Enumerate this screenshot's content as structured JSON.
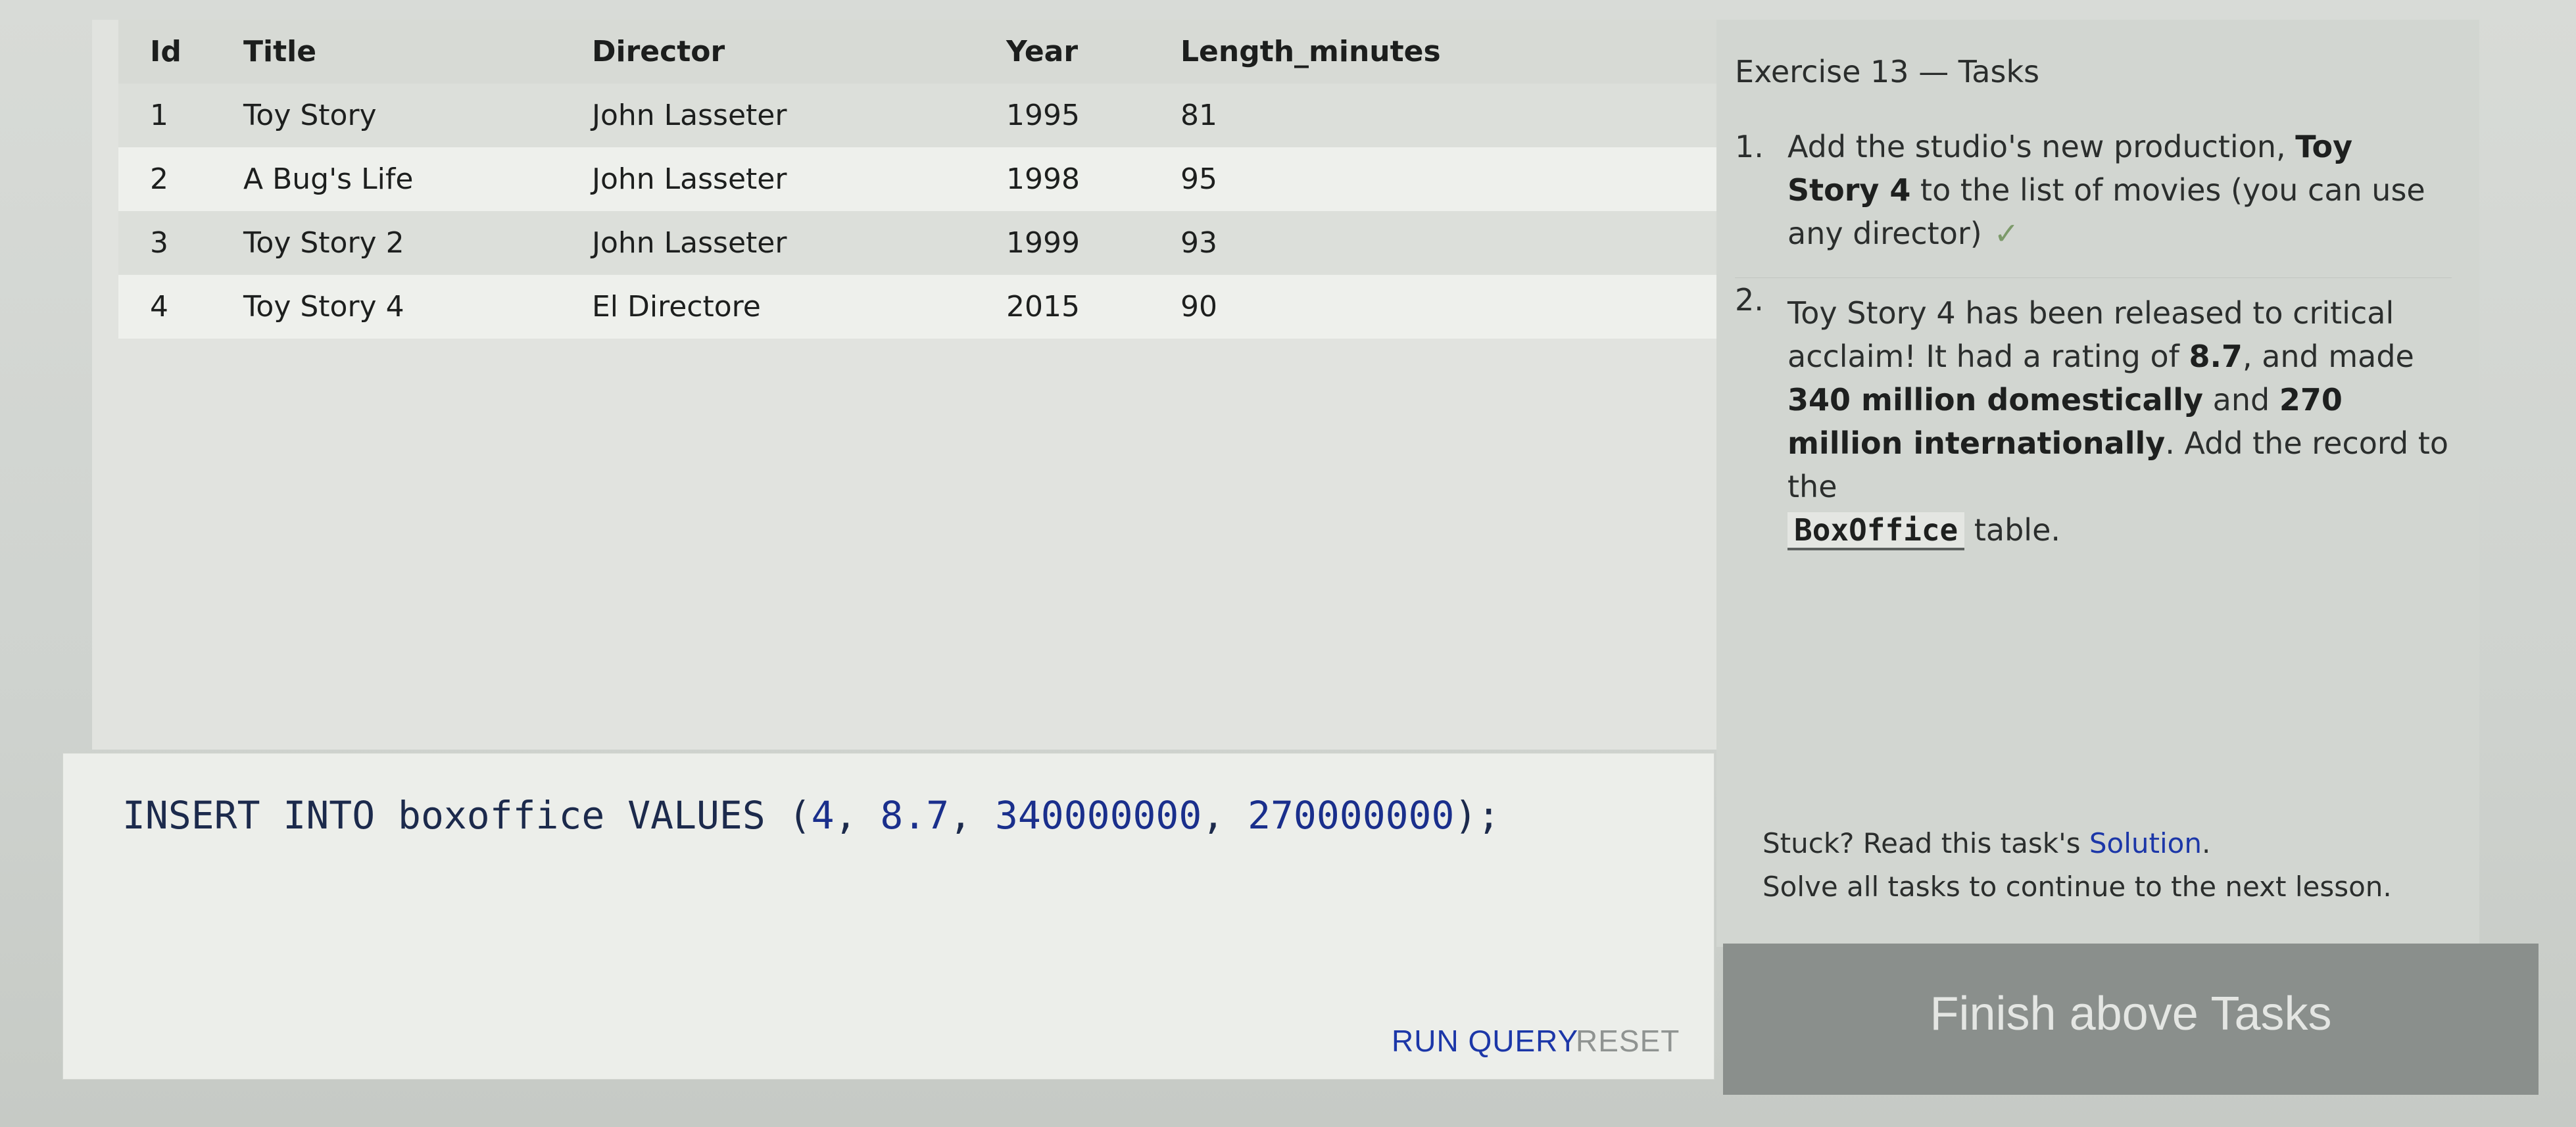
{
  "table": {
    "headers": [
      "Id",
      "Title",
      "Director",
      "Year",
      "Length_minutes"
    ],
    "rows": [
      [
        "1",
        "Toy Story",
        "John Lasseter",
        "1995",
        "81"
      ],
      [
        "2",
        "A Bug's Life",
        "John Lasseter",
        "1998",
        "95"
      ],
      [
        "3",
        "Toy Story 2",
        "John Lasseter",
        "1999",
        "93"
      ],
      [
        "4",
        "Toy Story 4",
        "El Directore",
        "2015",
        "90"
      ]
    ]
  },
  "editor": {
    "sql_kw1": "INSERT INTO",
    "sql_table": "boxoffice",
    "sql_kw2": "VALUES",
    "sql_open": "(",
    "v1": "4",
    "v2": "8.7",
    "v3": "340000000",
    "v4": "270000000",
    "sql_close": ");",
    "run_label": "RUN QUERY",
    "reset_label": "RESET"
  },
  "tasks": {
    "title": "Exercise 13 — Tasks",
    "task1": {
      "num": "1.",
      "text_a": "Add the studio's new production,",
      "bold_a": "Toy Story 4",
      "text_b": "to the list of movies (you can use any director)",
      "check": "✓"
    },
    "task2": {
      "num": "2.",
      "text_a": "Toy Story 4 has been released to critical acclaim! It had a rating of",
      "bold_a": "8.7",
      "text_b": ", and made",
      "bold_b": "340 million domestically",
      "text_c": "and",
      "bold_c": "270 million internationally",
      "text_d": ". Add the record to the",
      "code": "BoxOffice",
      "text_e": "table."
    },
    "stuck_prefix": "Stuck? Read this task's",
    "stuck_link": "Solution",
    "stuck_suffix": ".",
    "next_line": "Solve all tasks to continue to the next lesson.",
    "finish_label": "Finish above Tasks"
  },
  "colors": {
    "link": "#1c37a8",
    "finish_bg": "#8a8f8c",
    "check": "#7c9a6a"
  }
}
